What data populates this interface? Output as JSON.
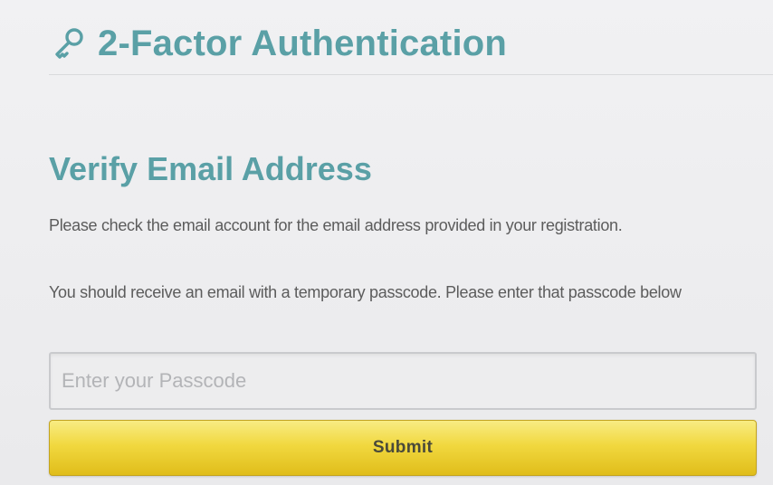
{
  "header": {
    "icon": "key-icon",
    "title": "2-Factor Authentication"
  },
  "verify": {
    "title": "Verify Email Address",
    "paragraph_1": "Please check the email account for the email address provided in your registration.",
    "paragraph_2": "You should receive an email with a temporary passcode. Please enter that passcode below"
  },
  "passcode": {
    "value": "",
    "placeholder": "Enter your Passcode"
  },
  "submit": {
    "label": "Submit"
  },
  "colors": {
    "heading": "#5aa0a6",
    "body_text": "#5c5c5c",
    "button": "#f1d83f"
  }
}
